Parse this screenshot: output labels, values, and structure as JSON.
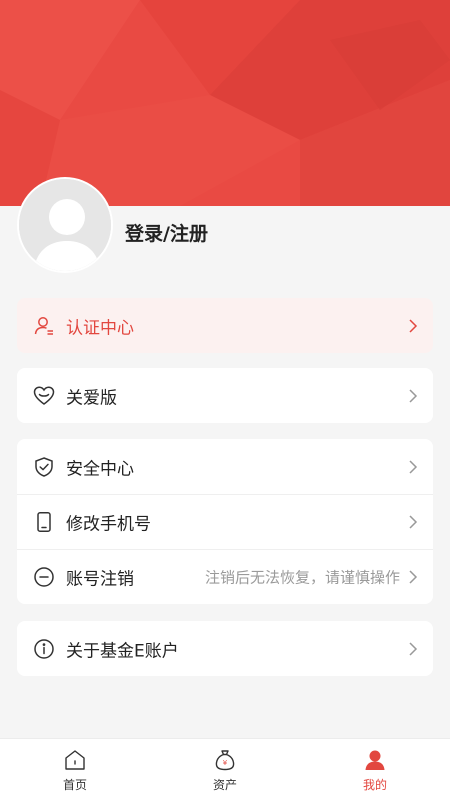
{
  "profile": {
    "login_label": "登录/注册"
  },
  "menu": {
    "cert": {
      "label": "认证中心",
      "icon": "user-cert-icon"
    },
    "care": {
      "label": "关爱版",
      "icon": "heart-icon"
    },
    "security": {
      "label": "安全中心",
      "icon": "shield-check-icon"
    },
    "phone": {
      "label": "修改手机号",
      "icon": "phone-icon"
    },
    "cancel": {
      "label": "账号注销",
      "note": "注销后无法恢复，请谨慎操作",
      "icon": "minus-circle-icon"
    },
    "about": {
      "label": "关于基金E账户",
      "icon": "info-circle-icon"
    }
  },
  "tabbar": {
    "items": [
      {
        "label": "首页",
        "icon": "home-icon",
        "active": false
      },
      {
        "label": "资产",
        "icon": "money-bag-icon",
        "active": false
      },
      {
        "label": "我的",
        "icon": "person-icon",
        "active": true
      }
    ]
  },
  "colors": {
    "accent": "#e2473f",
    "header_bg": "#e94a43",
    "page_bg": "#f5f5f5"
  }
}
